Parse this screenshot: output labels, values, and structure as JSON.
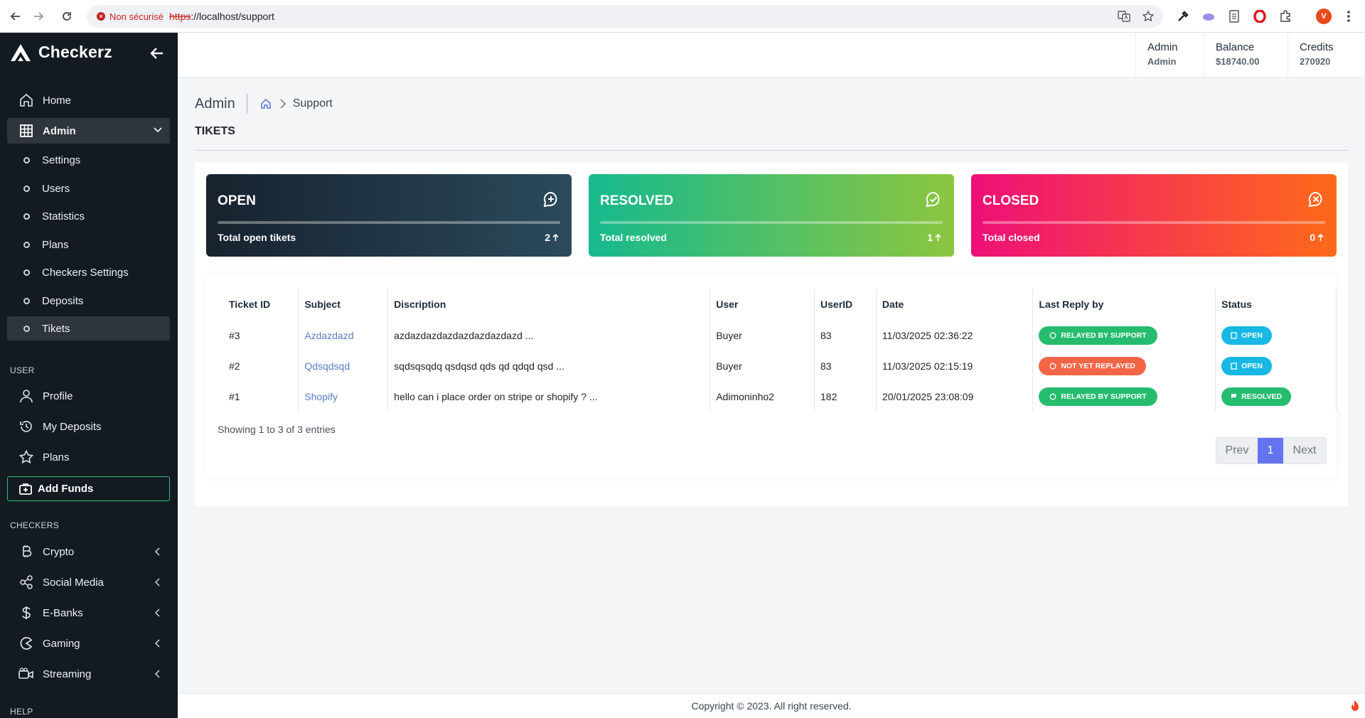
{
  "browser": {
    "security_label": "Non sécurisé",
    "url_protocol": "https",
    "url_rest": "://localhost/support",
    "profile_initial": "V"
  },
  "sidebar": {
    "brand": "Checkerz",
    "items": {
      "home": "Home",
      "admin": "Admin",
      "settings": "Settings",
      "users": "Users",
      "statistics": "Statistics",
      "plans_admin": "Plans",
      "checkers_settings": "Checkers Settings",
      "deposits": "Deposits",
      "tikets": "Tikets",
      "profile": "Profile",
      "my_deposits": "My Deposits",
      "plans": "Plans",
      "add_funds": "Add Funds",
      "crypto": "Crypto",
      "social_media": "Social Media",
      "ebanks": "E-Banks",
      "gaming": "Gaming",
      "streaming": "Streaming"
    },
    "sections": {
      "user": "USER",
      "checkers": "CHECKERS",
      "help": "HELP"
    }
  },
  "header": {
    "admin_title": "Admin",
    "admin_sub": "Admin",
    "balance_title": "Balance",
    "balance_value": "$18740.00",
    "credits_title": "Credits",
    "credits_value": "270920"
  },
  "breadcrumb": {
    "root": "Admin",
    "current": "Support"
  },
  "page_title": "TIKETS",
  "stats": {
    "open": {
      "title": "OPEN",
      "label": "Total open tikets",
      "count": "2"
    },
    "resolved": {
      "title": "RESOLVED",
      "label": "Total resolved",
      "count": "1"
    },
    "closed": {
      "title": "CLOSED",
      "label": "Total closed",
      "count": "0"
    }
  },
  "table": {
    "headers": {
      "id": "Ticket ID",
      "subject": "Subject",
      "description": "Discription",
      "user": "User",
      "userid": "UserID",
      "date": "Date",
      "last_reply": "Last Reply by",
      "status": "Status"
    },
    "rows": [
      {
        "id": "#3",
        "subject": "Azdazdazd",
        "description": "azdazdazdazdazdazdazdazd ...",
        "user": "Buyer",
        "userid": "83",
        "date": "11/03/2025 02:36:22",
        "last_reply": "RELAYED BY SUPPORT",
        "status": "OPEN"
      },
      {
        "id": "#2",
        "subject": "Qdsqdsqd",
        "description": "sqdsqsqdq qsdqsd qds qd qdqd qsd ...",
        "user": "Buyer",
        "userid": "83",
        "date": "11/03/2025 02:15:19",
        "last_reply": "NOT YET REPLAYED",
        "status": "OPEN"
      },
      {
        "id": "#1",
        "subject": "Shopify",
        "description": "hello can i place order on stripe or shopify ? ...",
        "user": "Adimoninho2",
        "userid": "182",
        "date": "20/01/2025 23:08:09",
        "last_reply": "RELAYED BY SUPPORT",
        "status": "RESOLVED"
      }
    ],
    "showing": "Showing 1 to 3 of 3 entries"
  },
  "pagination": {
    "prev": "Prev",
    "page": "1",
    "next": "Next"
  },
  "footer": "Copyright © 2023. All right reserved.",
  "colors": {
    "sidebar_bg": "#131a22",
    "accent": "#6474ee",
    "badge_green": "#26bc6e",
    "badge_red": "#f26647",
    "badge_cyan": "#17b8e3"
  }
}
